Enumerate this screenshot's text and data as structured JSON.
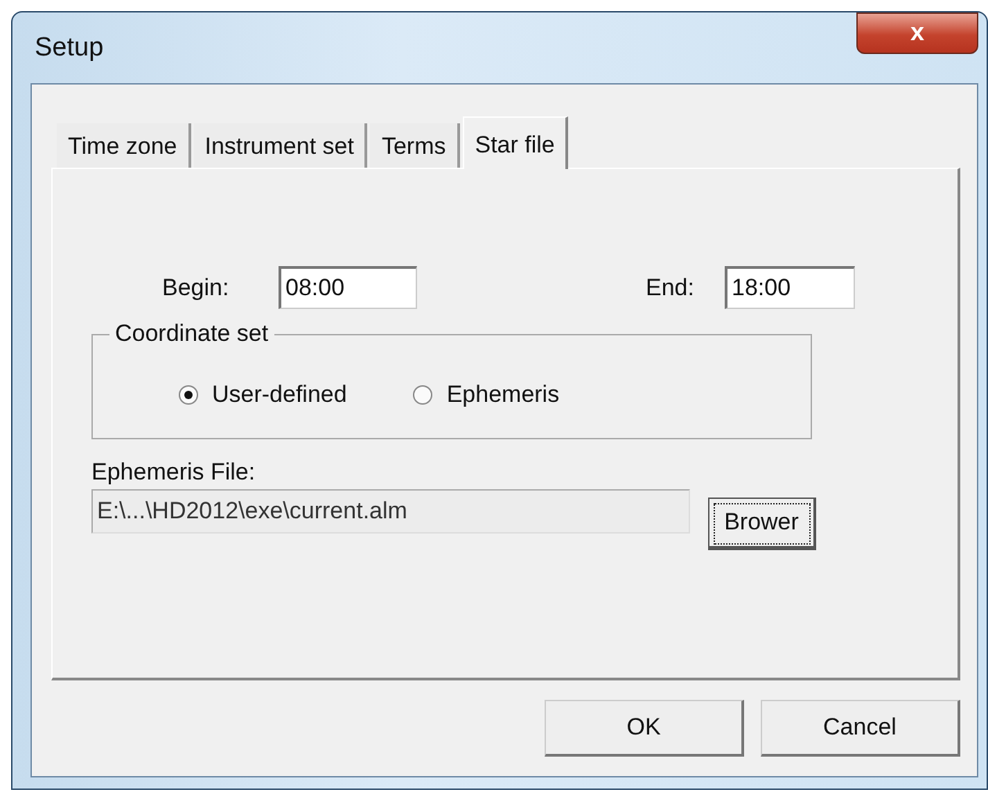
{
  "window": {
    "title": "Setup",
    "close": "x"
  },
  "tabs": [
    {
      "label": "Time zone",
      "selected": false
    },
    {
      "label": "Instrument set",
      "selected": false
    },
    {
      "label": "Terms",
      "selected": false
    },
    {
      "label": "Star file",
      "selected": true
    }
  ],
  "begin": {
    "label": "Begin:",
    "value": "08:00"
  },
  "end": {
    "label": "End:",
    "value": "18:00"
  },
  "coordinate_set": {
    "title": "Coordinate set",
    "options": [
      {
        "label": "User-defined",
        "selected": true
      },
      {
        "label": "Ephemeris",
        "selected": false
      }
    ]
  },
  "ephemeris_file": {
    "label": "Ephemeris File:",
    "value": "E:\\...\\HD2012\\exe\\current.alm",
    "browse": "Brower"
  },
  "buttons": [
    "OK",
    "Cancel"
  ]
}
